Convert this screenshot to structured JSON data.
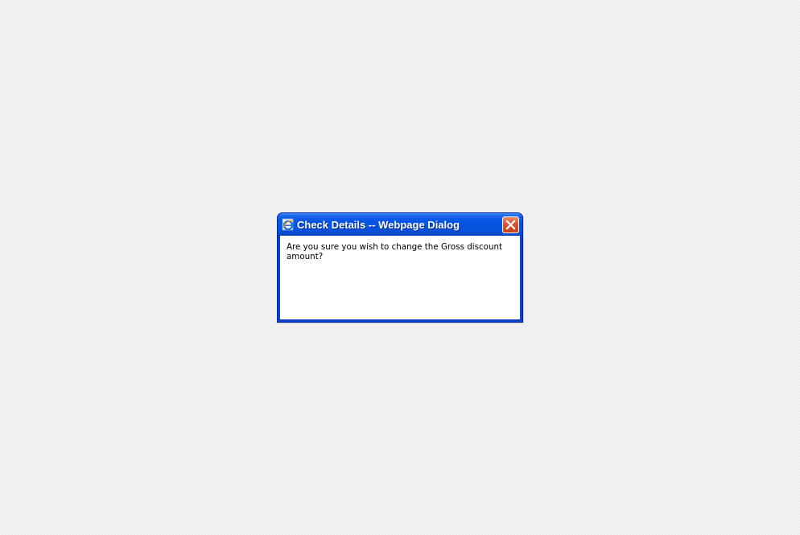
{
  "dialog": {
    "title": "Check Details -- Webpage Dialog",
    "icon": "internet-explorer-icon",
    "close_icon": "close-icon",
    "message": "Are you sure you wish to change the Gross discount amount?"
  },
  "colors": {
    "titlebar": "#0654e3",
    "frame": "#0a3fcf",
    "close_button": "#d8532f",
    "client_background": "#ffffff",
    "desktop_background": "#f4f4f4"
  }
}
